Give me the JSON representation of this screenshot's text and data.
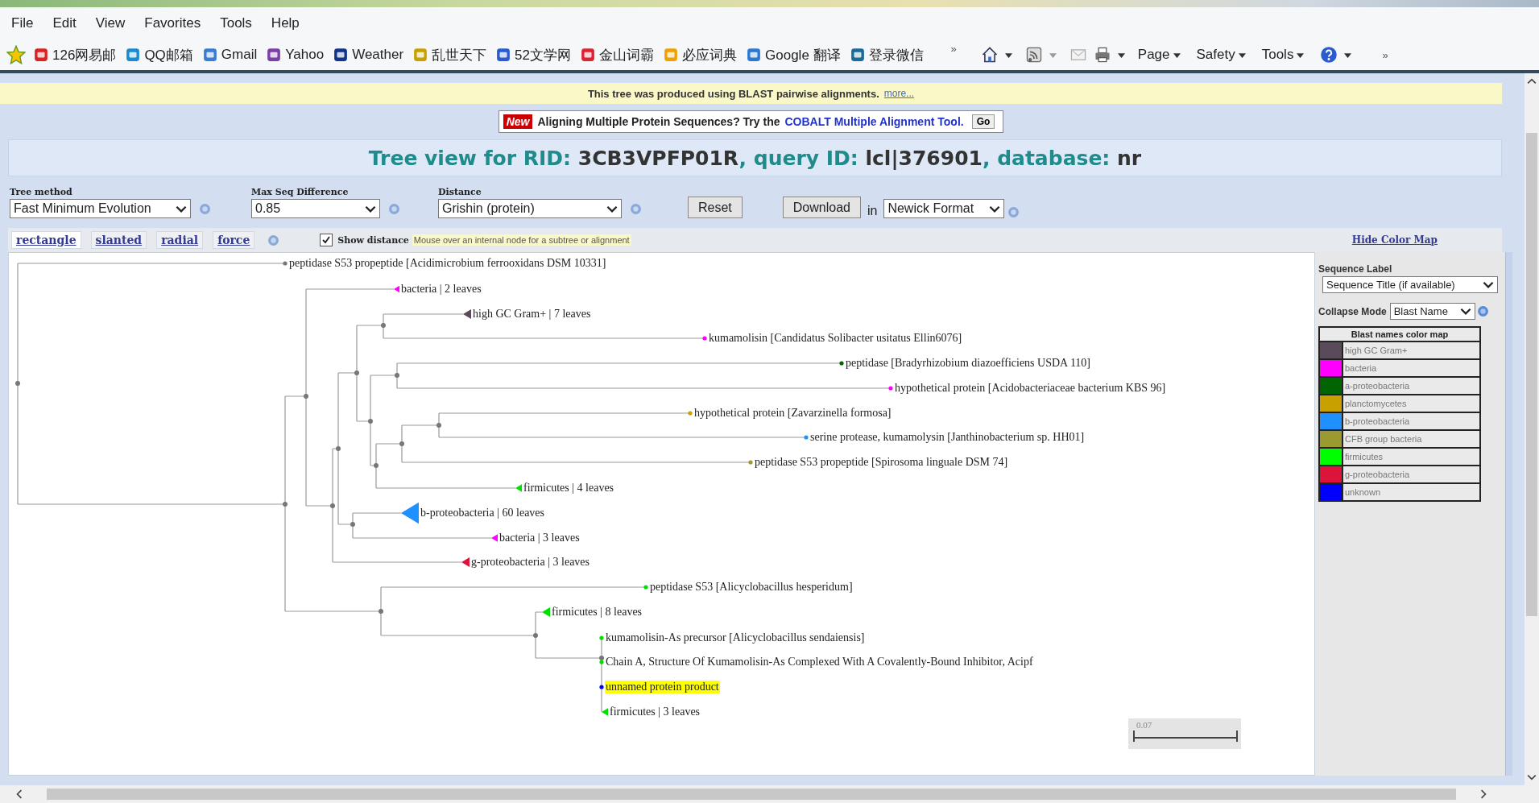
{
  "menu": [
    "File",
    "Edit",
    "View",
    "Favorites",
    "Tools",
    "Help"
  ],
  "favorites": [
    "126网易邮",
    "QQ邮箱",
    "Gmail",
    "Yahoo",
    "Weather",
    "乱世天下",
    "52文学网",
    "金山词霸",
    "必应词典",
    "Google 翻译",
    "登录微信"
  ],
  "favorites_more": "»",
  "command_bar": {
    "items": [
      "Page",
      "Safety",
      "Tools"
    ],
    "more": "»"
  },
  "banner": {
    "text": "This tree was produced using BLAST pairwise alignments.",
    "link": "more..."
  },
  "promo": {
    "badge": "New",
    "text": "Aligning Multiple Protein Sequences? Try the",
    "link": "COBALT Multiple Alignment Tool.",
    "button": "Go"
  },
  "title": [
    {
      "text": "Tree view for RID: ",
      "kind": "label"
    },
    {
      "text": "3CB3VPFP01R",
      "kind": "value"
    },
    {
      "text": ", query ID: ",
      "kind": "label"
    },
    {
      "text": "lcl|376901",
      "kind": "value"
    },
    {
      "text": ", database: ",
      "kind": "label"
    },
    {
      "text": "nr",
      "kind": "value"
    }
  ],
  "controls": {
    "tree_method": {
      "label": "Tree method",
      "value": "Fast Minimum Evolution"
    },
    "max_seq_difference": {
      "label": "Max Seq Difference",
      "value": "0.85"
    },
    "distance": {
      "label": "Distance",
      "value": "Grishin (protein)"
    },
    "reset": "Reset",
    "download": "Download",
    "in": "in",
    "format": "Newick Format"
  },
  "view_tabs": [
    {
      "label": "rectangle",
      "selected": true
    },
    {
      "label": "slanted",
      "selected": false
    },
    {
      "label": "radial",
      "selected": false
    },
    {
      "label": "force",
      "selected": false
    }
  ],
  "show_distance": {
    "label": "Show distance",
    "checked": true
  },
  "hint": "Mouse over an internal node for a subtree or alignment",
  "hide_color_map": "Hide Color Map",
  "tree": {
    "children": [
      {
        "kind": "leaf",
        "label": "peptidase S53 propeptide [Acidimicrobium ferrooxidans DSM 10331]",
        "color": "#777777",
        "highlighted": false
      },
      {
        "children": [
          {
            "children": [
              {
                "kind": "collapsed",
                "label": "bacteria | 2 leaves",
                "color": "#ff00ff",
                "highlighted": false
              },
              {
                "children": [
                  {
                    "children": [
                      {
                        "children": [
                          {
                            "children": [
                              {
                                "kind": "collapsed",
                                "label": "high GC Gram+ | 7 leaves",
                                "color": "#5a4a5a",
                                "highlighted": false
                              },
                              {
                                "kind": "leaf",
                                "label": "kumamolisin [Candidatus Solibacter usitatus Ellin6076]",
                                "color": "#ff00ff",
                                "highlighted": false
                              }
                            ]
                          },
                          {
                            "children": [
                              {
                                "children": [
                                  {
                                    "kind": "leaf",
                                    "label": "peptidase [Bradyrhizobium diazoefficiens USDA 110]",
                                    "color": "#006400",
                                    "highlighted": false
                                  },
                                  {
                                    "kind": "leaf",
                                    "label": "hypothetical protein [Acidobacteriaceae bacterium KBS 96]",
                                    "color": "#ff00ff",
                                    "highlighted": false
                                  }
                                ]
                              },
                              {
                                "children": [
                                  {
                                    "children": [
                                      {
                                        "children": [
                                          {
                                            "kind": "leaf",
                                            "label": "hypothetical protein [Zavarzinella formosa]",
                                            "color": "#c8a000",
                                            "highlighted": false
                                          },
                                          {
                                            "kind": "leaf",
                                            "label": "serine protease, kumamolysin [Janthinobacterium sp. HH01]",
                                            "color": "#1e90ff",
                                            "highlighted": false
                                          }
                                        ]
                                      },
                                      {
                                        "kind": "leaf",
                                        "label": "peptidase S53 propeptide [Spirosoma linguale DSM 74]",
                                        "color": "#9a9a30",
                                        "highlighted": false
                                      }
                                    ]
                                  },
                                  {
                                    "kind": "collapsed",
                                    "label": "firmicutes | 4 leaves",
                                    "color": "#00e000",
                                    "highlighted": false
                                  }
                                ]
                              }
                            ]
                          }
                        ]
                      },
                      {
                        "children": [
                          {
                            "kind": "collapsed",
                            "label": "b-proteobacteria | 60 leaves",
                            "color": "#1e90ff",
                            "highlighted": false
                          },
                          {
                            "kind": "collapsed",
                            "label": "bacteria | 3 leaves",
                            "color": "#ff00ff",
                            "highlighted": false
                          }
                        ]
                      }
                    ]
                  },
                  {
                    "kind": "collapsed",
                    "label": "g-proteobacteria | 3 leaves",
                    "color": "#dc143c",
                    "highlighted": false
                  }
                ]
              }
            ]
          },
          {
            "children": [
              {
                "kind": "leaf",
                "label": "peptidase S53 [Alicyclobacillus hesperidum]",
                "color": "#00e000",
                "highlighted": false
              },
              {
                "children": [
                  {
                    "kind": "collapsed",
                    "label": "firmicutes | 8 leaves",
                    "color": "#00e000",
                    "highlighted": false
                  },
                  {
                    "children": [
                      {
                        "kind": "leaf",
                        "label": "kumamolisin-As precursor [Alicyclobacillus sendaiensis]",
                        "color": "#00e000",
                        "highlighted": false
                      },
                      {
                        "kind": "leaf",
                        "label": "Chain A, Structure Of Kumamolisin-As Complexed With A Covalently-Bound Inhibitor, Acipf",
                        "color": "#00e000",
                        "highlighted": false
                      },
                      {
                        "kind": "leaf",
                        "label": "unnamed protein product",
                        "color": "#0000ff",
                        "highlighted": true
                      },
                      {
                        "kind": "collapsed",
                        "label": "firmicutes | 3 leaves",
                        "color": "#00e000",
                        "highlighted": false
                      }
                    ]
                  }
                ]
              }
            ]
          }
        ]
      }
    ]
  },
  "scale_bar": "0.07",
  "side_panel": {
    "sequence_label": {
      "label": "Sequence Label",
      "value": "Sequence Title (if available)"
    },
    "collapse_mode": {
      "label": "Collapse Mode",
      "value": "Blast Name"
    },
    "color_map": {
      "title": "Blast names color map",
      "entries": [
        {
          "label": "high GC Gram+",
          "color": "#5a4a5a"
        },
        {
          "label": "bacteria",
          "color": "#ff00ff"
        },
        {
          "label": "a-proteobacteria",
          "color": "#006400"
        },
        {
          "label": "planctomycetes",
          "color": "#c8a000"
        },
        {
          "label": "b-proteobacteria",
          "color": "#1e90ff"
        },
        {
          "label": "CFB group bacteria",
          "color": "#9a9a30"
        },
        {
          "label": "firmicutes",
          "color": "#00ff00"
        },
        {
          "label": "g-proteobacteria",
          "color": "#dc143c"
        },
        {
          "label": "unknown",
          "color": "#0000ff"
        }
      ]
    }
  }
}
